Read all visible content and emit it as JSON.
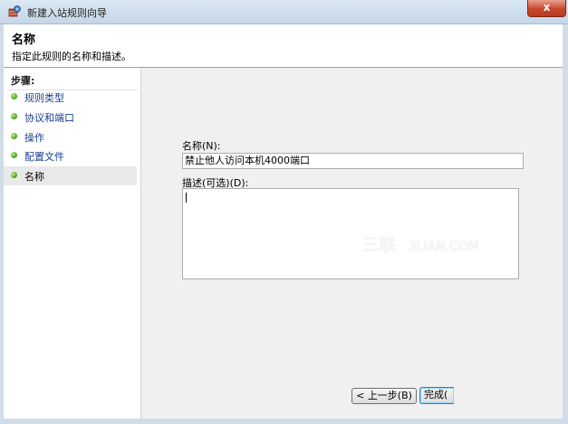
{
  "window": {
    "title": "新建入站规则向导",
    "close_glyph": "x"
  },
  "header": {
    "title": "名称",
    "subtitle": "指定此规则的名称和描述。"
  },
  "sidebar": {
    "steps_label": "步骤:",
    "items": [
      {
        "label": "规则类型"
      },
      {
        "label": "协议和端口"
      },
      {
        "label": "操作"
      },
      {
        "label": "配置文件"
      },
      {
        "label": "名称"
      }
    ],
    "current_index": 4
  },
  "form": {
    "name_label": "名称(N):",
    "name_value": "禁止他人访问本机4000端口",
    "description_label": "描述(可选)(D):",
    "description_value": ""
  },
  "buttons": {
    "back_label": "< 上一步(B)",
    "finish_label": "完成("
  },
  "watermark": {
    "cn": "三联",
    "en": "3LIAN.COM"
  },
  "colors": {
    "titlebar": "#c5d6e7",
    "link": "#1a3f8f",
    "bullet": "#3f9d16",
    "content_bg": "#f0f0f0"
  }
}
